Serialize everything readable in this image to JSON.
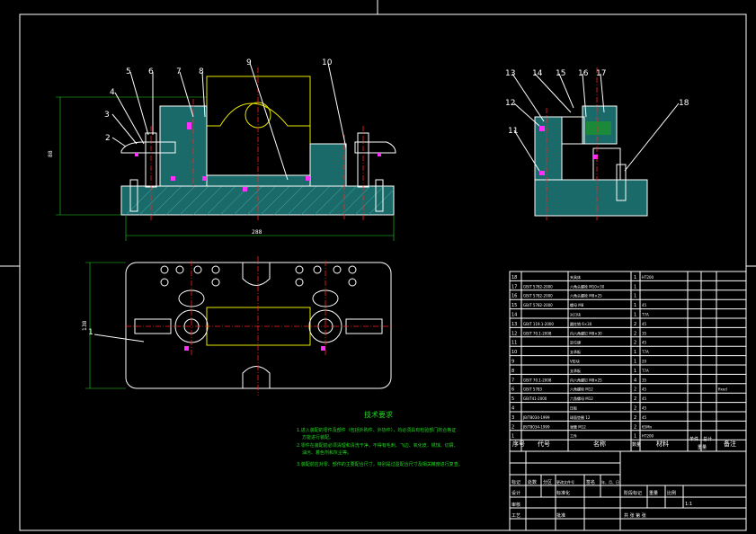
{
  "balloons_front": [
    "1",
    "2",
    "3",
    "4",
    "5",
    "6",
    "7",
    "8",
    "9",
    "10"
  ],
  "balloons_side": [
    "11",
    "12",
    "13",
    "14",
    "15",
    "16",
    "17",
    "18"
  ],
  "dims": {
    "height": "88",
    "width": "288",
    "plan_height": "138"
  },
  "tech_req": {
    "title": "技术要求",
    "items": [
      "1.进入装配的零件及部件（包括外购件、外协件），均必须具有检验部门的合格证",
      "方能进行装配。",
      "2.零件在装配前必须清理和清洗干净，不得有毛刺、飞边、氧化皮、锈蚀、切屑、",
      "油污、着色剂和灰尘等。",
      "3.装配前应对零、部件的主要配合尺寸，特别是过盈配合尺寸及相关精度进行复查。"
    ]
  },
  "bom": {
    "rows": [
      {
        "no": "18",
        "code": "",
        "name": "夹具体",
        "qty": "1",
        "mat": "HT200",
        "note": ""
      },
      {
        "no": "17",
        "code": "GB/T 5782-2000",
        "name": "六角头螺栓 M10×30",
        "qty": "1",
        "mat": "",
        "note": ""
      },
      {
        "no": "16",
        "code": "GB/T 5782-2000",
        "name": "六角头螺栓 M8×25",
        "qty": "1",
        "mat": "",
        "note": ""
      },
      {
        "no": "15",
        "code": "GB/T 5782-2000",
        "name": "螺母 M8",
        "qty": "1",
        "mat": "45",
        "note": ""
      },
      {
        "no": "14",
        "code": "",
        "name": "对刀块",
        "qty": "1",
        "mat": "T7A",
        "note": ""
      },
      {
        "no": "13",
        "code": "GB/T 119.1-2000",
        "name": "圆柱销 6×30",
        "qty": "2",
        "mat": "45",
        "note": ""
      },
      {
        "no": "12",
        "code": "GB/T 70.1-2008",
        "name": "内六角螺钉 M8×30",
        "qty": "2",
        "mat": "35",
        "note": ""
      },
      {
        "no": "11",
        "code": "",
        "name": "定位键",
        "qty": "2",
        "mat": "45",
        "note": ""
      },
      {
        "no": "10",
        "code": "",
        "name": "支承板",
        "qty": "1",
        "mat": "T7A",
        "note": ""
      },
      {
        "no": "9",
        "code": "",
        "name": "V形块",
        "qty": "1",
        "mat": "20",
        "note": ""
      },
      {
        "no": "8",
        "code": "",
        "name": "支承板",
        "qty": "1",
        "mat": "T7A",
        "note": ""
      },
      {
        "no": "7",
        "code": "GB/T 70.1-2008",
        "name": "内六角螺钉 M8×25",
        "qty": "4",
        "mat": "35",
        "note": ""
      },
      {
        "no": "6",
        "code": "GB/T 5783",
        "name": "六角螺栓 M12",
        "qty": "2",
        "mat": "45",
        "note": "fixed"
      },
      {
        "no": "5",
        "code": "GB/T41-2000",
        "name": "六角螺母 M12",
        "qty": "2",
        "mat": "45",
        "note": ""
      },
      {
        "no": "4",
        "code": "",
        "name": "压板",
        "qty": "2",
        "mat": "45",
        "note": ""
      },
      {
        "no": "3",
        "code": "JB/T8034-1999",
        "name": "球面垫圈 12",
        "qty": "2",
        "mat": "45",
        "note": ""
      },
      {
        "no": "2",
        "code": "JB/T8034-1999",
        "name": "弹簧 M12",
        "qty": "2",
        "mat": "65Mn",
        "note": ""
      },
      {
        "no": "1",
        "code": "",
        "name": "工件",
        "qty": "1",
        "mat": "HT200",
        "note": ""
      }
    ],
    "header": {
      "no": "序号",
      "code": "代号",
      "name": "名称",
      "qty": "数量",
      "mat": "材料",
      "unit": "单件",
      "total": "总计",
      "weight": "重量",
      "note": "备注"
    }
  },
  "title_block": {
    "labels": [
      "标记",
      "处数",
      "分区",
      "更改文件号",
      "签名",
      "年、月、日",
      "设计",
      "标准化",
      "阶段标记",
      "重量",
      "比例",
      "审核",
      "工艺",
      "批准",
      "共  张  第  张"
    ],
    "scale": "1:1"
  }
}
